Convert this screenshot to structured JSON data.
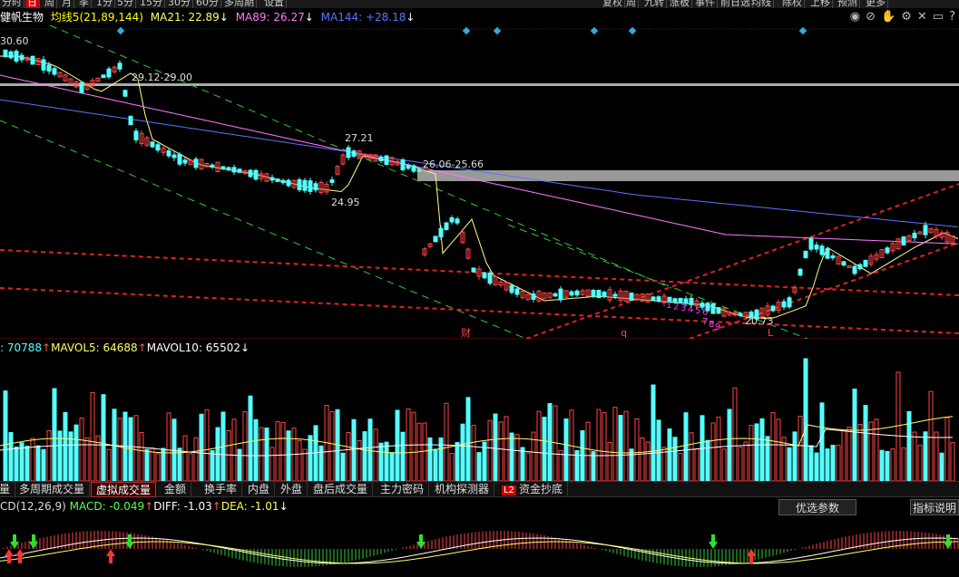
{
  "toolbar": {
    "buttons": [
      {
        "label": "分时",
        "active": false
      },
      {
        "label": "日",
        "active": true
      },
      {
        "label": "周",
        "active": false
      },
      {
        "label": "月",
        "active": false
      },
      {
        "label": "季",
        "active": false
      },
      {
        "label": "1分",
        "active": false
      },
      {
        "label": "5分",
        "active": false
      },
      {
        "label": "15分",
        "active": false
      },
      {
        "label": "30分",
        "active": false
      },
      {
        "label": "60分",
        "active": false
      },
      {
        "label": "多周期",
        "active": false
      },
      {
        "label": "设置",
        "active": false
      },
      {
        "label": "复权",
        "active": false
      },
      {
        "label": "周",
        "active": false
      },
      {
        "label": "九转",
        "active": false
      },
      {
        "label": "涨板",
        "active": false
      },
      {
        "label": "事件",
        "active": false
      },
      {
        "label": "前日选",
        "active": false
      },
      {
        "label": "均线",
        "active": false
      },
      {
        "label": "除权",
        "active": false
      },
      {
        "label": "上移",
        "active": false
      },
      {
        "label": "预测",
        "active": false
      },
      {
        "label": "更多",
        "active": false
      }
    ]
  },
  "legend": {
    "stock_name": "健帆生物",
    "ma_label": "均线5(21,89,144)",
    "ma21": "MA21: 22.89",
    "ma89": "MA89: 26.27",
    "ma144": "MA144: +28.18",
    "colors": {
      "name": "#ffffff",
      "ma_label": "#ffff00",
      "ma21": "#ffff66",
      "ma89": "#ff77ff",
      "ma144": "#5577ff"
    }
  },
  "toolbar_icons": [
    "eye-icon",
    "eye-off-icon",
    "hand-icon",
    "gear-icon",
    "close-icon",
    "window-icon",
    "help-icon"
  ],
  "toolbar_icon_glyphs": [
    "◉",
    "⊘",
    "✋",
    "⚙",
    "✕",
    "▭",
    "?"
  ],
  "annotations": {
    "high_left": "30.60",
    "range1": "29.12-29.00",
    "price_27": "27.21",
    "range2": "26.06-25.66",
    "price_24": "24.95",
    "price_low": "20.73",
    "event_cai": "财",
    "event_q": "q",
    "event_l": "L",
    "nine_count_up": [
      "1",
      "2",
      "3",
      "4",
      "5",
      "6"
    ],
    "nine_count_down": [
      "7",
      "8",
      "9"
    ]
  },
  "volume": {
    "vol": ": 70788",
    "mavol5": "MAVOL5: 64688",
    "mavol10": "MAVOL10: 65502"
  },
  "tabs": [
    {
      "label": "量",
      "active": false
    },
    {
      "label": "多周期成交量",
      "active": false
    },
    {
      "label": "虚拟成交量",
      "active": true
    },
    {
      "label": "金额",
      "active": false
    },
    {
      "label": "换手率",
      "active": false
    },
    {
      "label": "内盘",
      "active": false
    },
    {
      "label": "外盘",
      "active": false
    },
    {
      "label": "盘后成交量",
      "active": false
    },
    {
      "label": "主力密码",
      "active": false
    },
    {
      "label": "机构探测器",
      "active": false
    },
    {
      "label": "资金抄底",
      "active": false,
      "badge": "L2"
    }
  ],
  "macd": {
    "name": "CD(12,26,9)",
    "macd": "MACD: -0.049",
    "diff": "DIFF: -1.03",
    "dea": "DEA: -1.01",
    "params_button": "优选参数",
    "help_button": "指标说明"
  }
}
